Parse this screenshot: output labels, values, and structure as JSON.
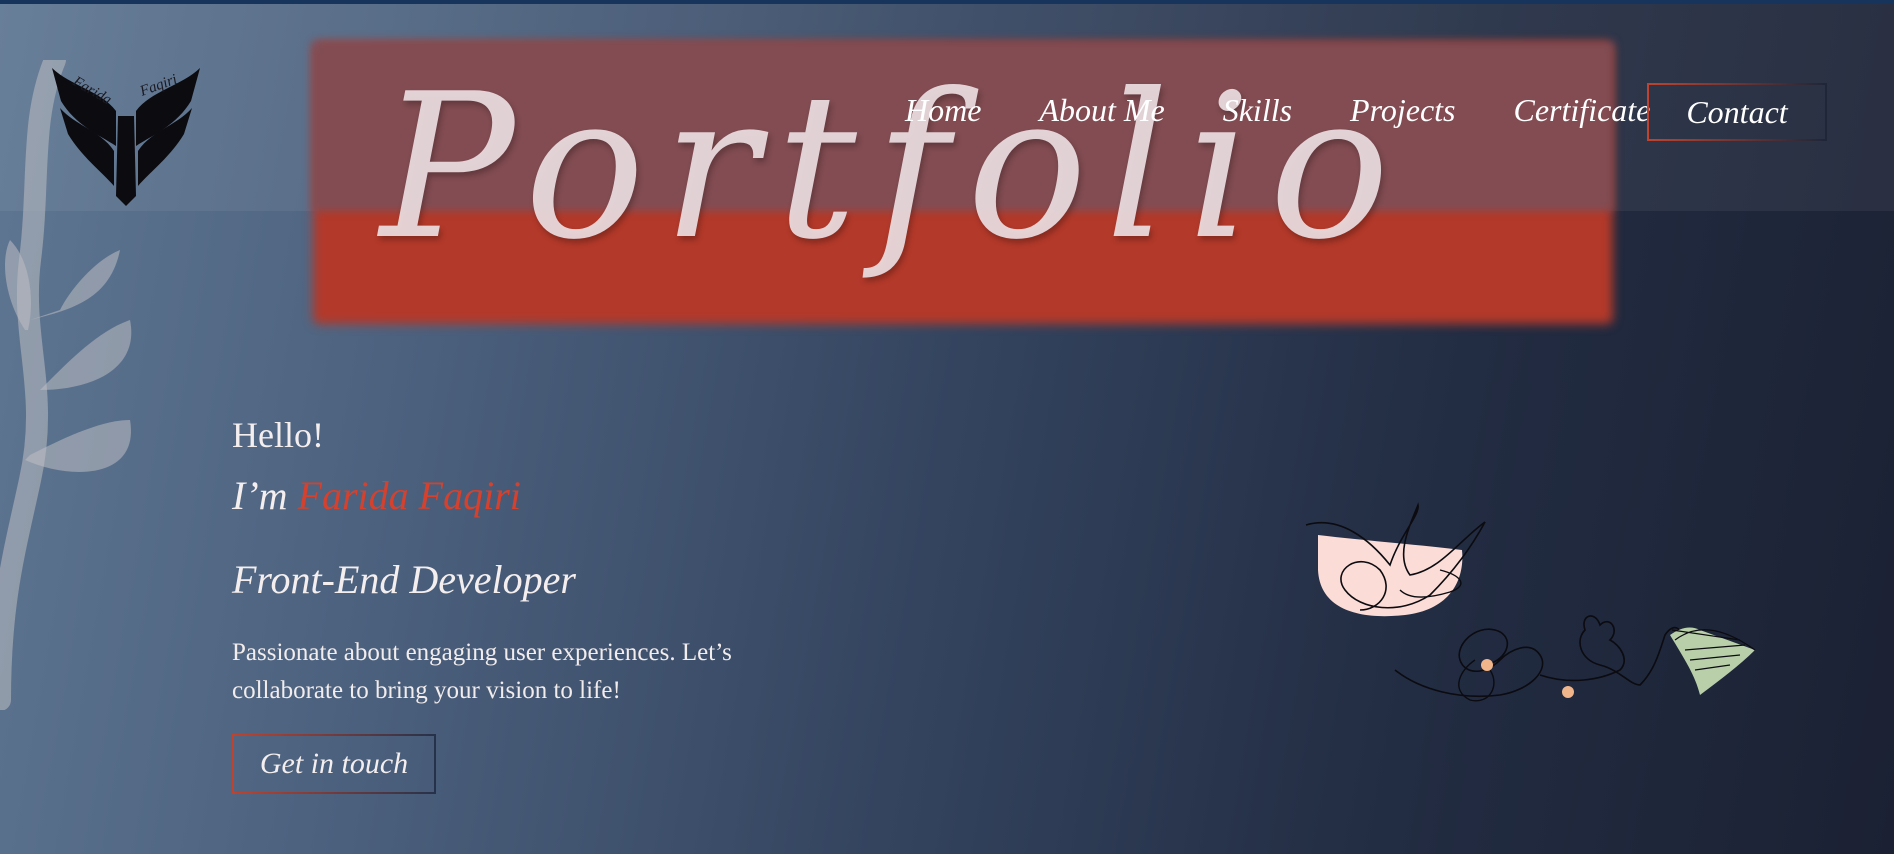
{
  "brand": {
    "logo_text_left": "Farida",
    "logo_text_right": "Faqiri",
    "icon": "butterfly-logo-icon"
  },
  "banner": {
    "word": "Portfolio"
  },
  "nav": {
    "items": [
      {
        "label": "Home"
      },
      {
        "label": "About Me"
      },
      {
        "label": "Skills"
      },
      {
        "label": "Projects"
      },
      {
        "label": "Certificate"
      }
    ],
    "contact_label": "Contact"
  },
  "hero": {
    "greeting": "Hello!",
    "intro_prefix": "I’m",
    "name": "Farida Faqiri",
    "role": "Front-End Developer",
    "description": "Passionate about engaging user experiences. Let’s collaborate to bring your vision to life!",
    "cta_label": "Get in touch"
  },
  "colors": {
    "accent": "#d5412d",
    "banner_red": "#b3392a",
    "bg_left": "#5f7793",
    "bg_right": "#1b2133"
  },
  "decor": {
    "left_vine": "vine-decoration",
    "right_illustration": "line-art-illustration"
  }
}
